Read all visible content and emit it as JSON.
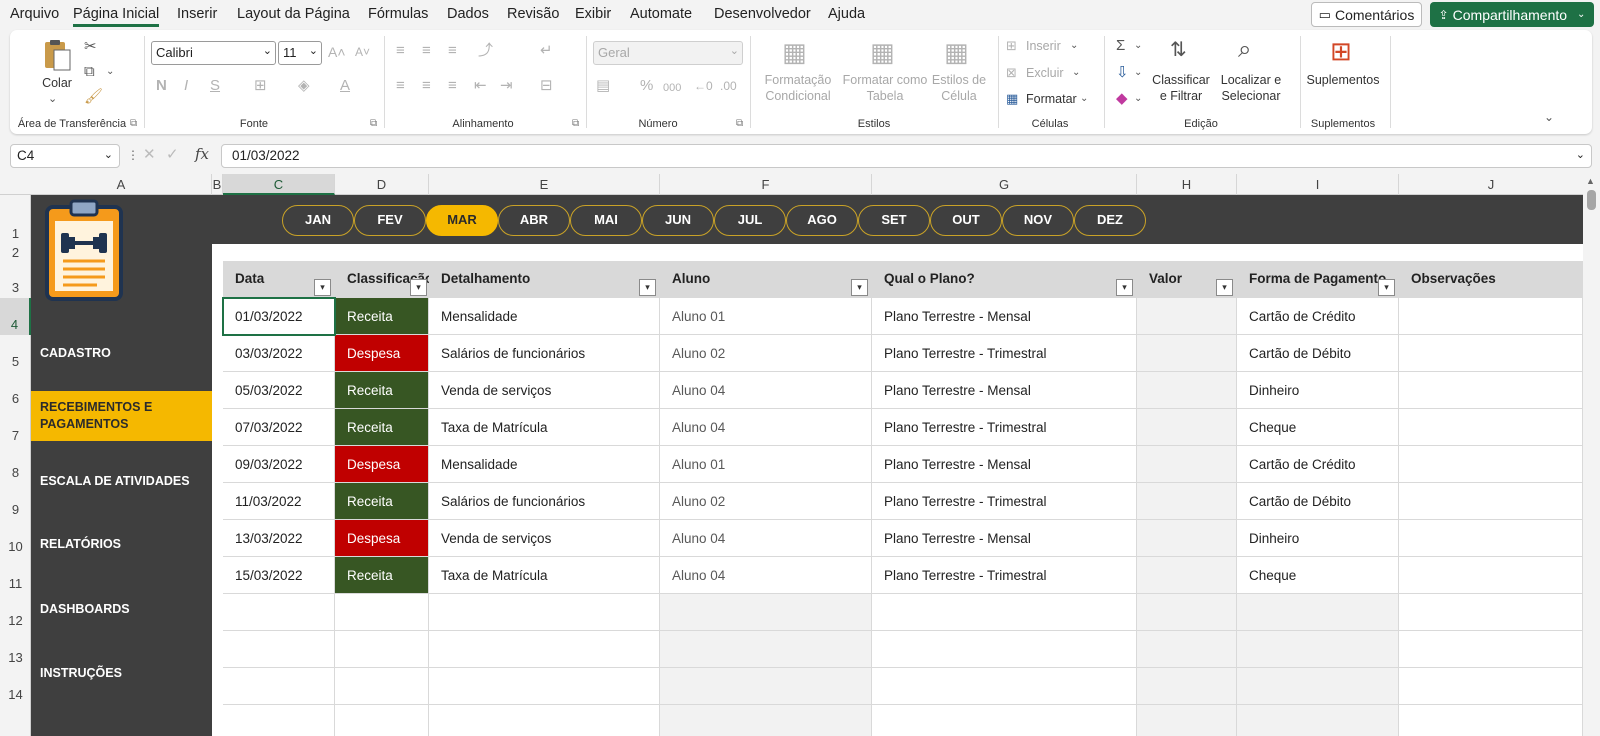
{
  "menu": {
    "items": [
      "Arquivo",
      "Página Inicial",
      "Inserir",
      "Layout da Página",
      "Fórmulas",
      "Dados",
      "Revisão",
      "Exibir",
      "Automate",
      "Desenvolvedor",
      "Ajuda"
    ],
    "comments_label": "Comentários",
    "share_label": "Compartilhamento"
  },
  "ribbon": {
    "clipboard": {
      "paste_label": "Colar",
      "group_label": "Área de Transferência"
    },
    "font": {
      "font_name": "Calibri",
      "font_size": "11",
      "group_label": "Fonte"
    },
    "alignment": {
      "group_label": "Alinhamento"
    },
    "number": {
      "format": "Geral",
      "group_label": "Número"
    },
    "styles": {
      "conditional_l1": "Formatação",
      "conditional_l2": "Condicional",
      "table_l1": "Formatar como",
      "table_l2": "Tabela",
      "cell_l1": "Estilos de",
      "cell_l2": "Célula",
      "group_label": "Estilos"
    },
    "cells": {
      "insert": "Inserir",
      "delete": "Excluir",
      "format": "Formatar",
      "group_label": "Células"
    },
    "editing": {
      "sort_l1": "Classificar",
      "sort_l2": "e Filtrar",
      "find_l1": "Localizar e",
      "find_l2": "Selecionar",
      "group_label": "Edição"
    },
    "addins": {
      "label": "Suplementos",
      "group_label": "Suplementos"
    }
  },
  "formula_bar": {
    "cell_ref": "C4",
    "fx": "fx",
    "value": "01/03/2022"
  },
  "columns": [
    "A",
    "B",
    "C",
    "D",
    "E",
    "F",
    "G",
    "H",
    "I",
    "J"
  ],
  "rows": [
    "1",
    "2",
    "3",
    "4",
    "5",
    "6",
    "7",
    "8",
    "9",
    "10",
    "11",
    "12",
    "13",
    "14"
  ],
  "sidebar": {
    "items": [
      {
        "label": "CADASTRO"
      },
      {
        "label": "RECEBIMENTOS E PAGAMENTOS"
      },
      {
        "label": "ESCALA DE ATIVIDADES"
      },
      {
        "label": "RELATÓRIOS"
      },
      {
        "label": "DASHBOARDS"
      },
      {
        "label": "INSTRUÇÕES"
      }
    ]
  },
  "months": [
    "JAN",
    "FEV",
    "MAR",
    "ABR",
    "MAI",
    "JUN",
    "JUL",
    "AGO",
    "SET",
    "OUT",
    "NOV",
    "DEZ"
  ],
  "table": {
    "headers": [
      "Data",
      "Classificação",
      "Detalhamento",
      "Aluno",
      "Qual o Plano?",
      "Valor",
      "Forma de Pagamento",
      "Observações"
    ],
    "rows": [
      [
        "01/03/2022",
        "Receita",
        "Mensalidade",
        "Aluno 01",
        "Plano Terrestre - Mensal",
        "",
        "Cartão de Crédito",
        ""
      ],
      [
        "03/03/2022",
        "Despesa",
        "Salários de funcionários",
        "Aluno 02",
        "Plano Terrestre - Trimestral",
        "",
        "Cartão de Débito",
        ""
      ],
      [
        "05/03/2022",
        "Receita",
        "Venda de serviços",
        "Aluno 04",
        "Plano Terrestre - Mensal",
        "",
        "Dinheiro",
        ""
      ],
      [
        "07/03/2022",
        "Receita",
        "Taxa de Matrícula",
        "Aluno 04",
        "Plano Terrestre - Trimestral",
        "",
        "Cheque",
        ""
      ],
      [
        "09/03/2022",
        "Despesa",
        "Mensalidade",
        "Aluno 01",
        "Plano Terrestre - Mensal",
        "",
        "Cartão de Crédito",
        ""
      ],
      [
        "11/03/2022",
        "Receita",
        "Salários de funcionários",
        "Aluno 02",
        "Plano Terrestre - Trimestral",
        "",
        "Cartão de Débito",
        ""
      ],
      [
        "13/03/2022",
        "Despesa",
        "Venda de serviços",
        "Aluno 04",
        "Plano Terrestre - Mensal",
        "",
        "Dinheiro",
        ""
      ],
      [
        "15/03/2022",
        "Receita",
        "Taxa de Matrícula",
        "Aluno 04",
        "Plano Terrestre - Trimestral",
        "",
        "Cheque",
        ""
      ]
    ]
  },
  "colors": {
    "accent": "#f5b800",
    "dark": "#3f3f3f",
    "receita": "#375623",
    "despesa": "#c00000",
    "excel_green": "#1e7145"
  }
}
